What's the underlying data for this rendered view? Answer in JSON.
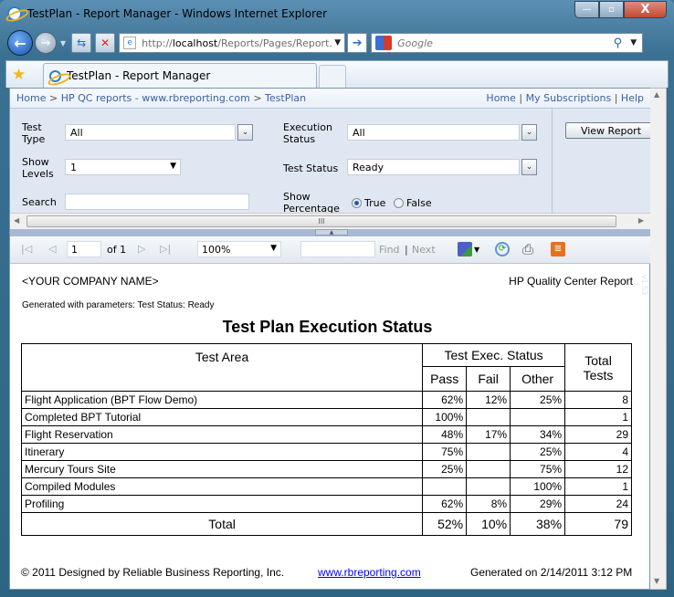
{
  "window": {
    "title": "TestPlan - Report Manager - Windows Internet Explorer",
    "controls": {
      "minimize": "—",
      "maximize": "▫",
      "close": "X"
    }
  },
  "nav": {
    "address_host": "localhost",
    "address_prefix": "http://",
    "address_rest": "/Reports/Pages/Report.",
    "search_placeholder": "Google"
  },
  "tabs": [
    {
      "label": "TestPlan - Report Manager"
    }
  ],
  "breadcrumb": {
    "items": [
      "Home",
      "HP QC reports - www.rbreporting.com",
      "TestPlan"
    ],
    "separator": ">"
  },
  "top_links": [
    "Home",
    "My Subscriptions",
    "Help"
  ],
  "params": {
    "test_type": {
      "label_line1": "Test",
      "label_line2": "Type",
      "value": "All"
    },
    "execution_status": {
      "label_line1": "Execution",
      "label_line2": "Status",
      "value": "All"
    },
    "show_levels": {
      "label_line1": "Show",
      "label_line2": "Levels",
      "value": "1"
    },
    "test_status": {
      "label": "Test Status",
      "value": "Ready"
    },
    "search": {
      "label": "Search",
      "value": ""
    },
    "show_percentage": {
      "label_line1": "Show",
      "label_line2": "Percentage",
      "options": [
        "True",
        "False"
      ],
      "selected": "True"
    },
    "view_report_label": "View Report"
  },
  "toolbar": {
    "page_current": "1",
    "page_of": "of 1",
    "zoom": "100%",
    "find_label": "Find",
    "separator": "|",
    "next_label": "Next"
  },
  "report": {
    "company": "<YOUR COMPANY NAME>",
    "header_right": "HP Quality Center Report",
    "version": "v1.53",
    "generated_params": "Generated with parameters: Test Status: Ready",
    "title": "Test Plan Execution Status",
    "columns": {
      "area": "Test Area",
      "exec_status": "Test Exec. Status",
      "pass": "Pass",
      "fail": "Fail",
      "other": "Other",
      "total_line1": "Total",
      "total_line2": "Tests"
    },
    "rows": [
      {
        "area": "Flight Application (BPT Flow Demo)",
        "pass": "62%",
        "fail": "12%",
        "other": "25%",
        "total": "8"
      },
      {
        "area": "Completed BPT Tutorial",
        "pass": "100%",
        "fail": "",
        "other": "",
        "total": "1"
      },
      {
        "area": "Flight Reservation",
        "pass": "48%",
        "fail": "17%",
        "other": "34%",
        "total": "29"
      },
      {
        "area": "Itinerary",
        "pass": "75%",
        "fail": "",
        "other": "25%",
        "total": "4"
      },
      {
        "area": "Mercury Tours Site",
        "pass": "25%",
        "fail": "",
        "other": "75%",
        "total": "12"
      },
      {
        "area": "Compiled Modules",
        "pass": "",
        "fail": "",
        "other": "100%",
        "total": "1"
      },
      {
        "area": "Profiling",
        "pass": "62%",
        "fail": "8%",
        "other": "29%",
        "total": "24"
      }
    ],
    "total_row": {
      "area": "Total",
      "pass": "52%",
      "fail": "10%",
      "other": "38%",
      "total": "79"
    },
    "footer": {
      "copyright": "© 2011 Designed by Reliable Business Reporting, Inc.",
      "link": "www.rbreporting.com",
      "generated": "Generated on 2/14/2011 3:12 PM"
    }
  }
}
